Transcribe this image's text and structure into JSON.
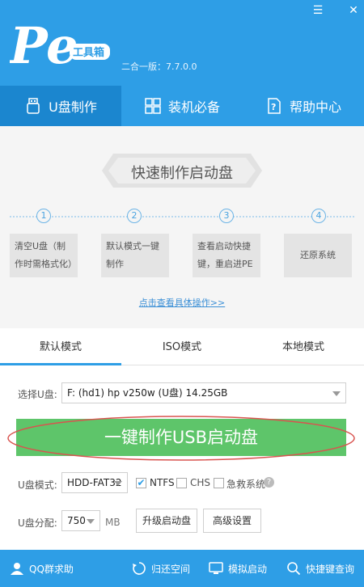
{
  "window": {
    "menu_glyph": "☰",
    "close_glyph": "✕"
  },
  "logo": {
    "badge_text": "工具箱"
  },
  "header": {
    "version": "二合一版：7.7.0.0"
  },
  "nav": {
    "tabs": [
      {
        "label": "U盘制作",
        "icon": "usb-icon"
      },
      {
        "label": "装机必备",
        "icon": "grid-icon"
      },
      {
        "label": "帮助中心",
        "icon": "help-icon"
      }
    ]
  },
  "steps": {
    "title": "快速制作启动盘",
    "numbers": [
      "1",
      "2",
      "3",
      "4"
    ],
    "items": [
      {
        "line1": "清空U盘（制",
        "line2": "作时需格式化）"
      },
      {
        "line1": "默认模式一键",
        "line2": "制作"
      },
      {
        "line1": "查看启动快捷",
        "line2": "键，重启进PE"
      },
      {
        "line1": "还原系统",
        "line2": ""
      }
    ],
    "link": "点击查看具体操作>>"
  },
  "modes": [
    "默认模式",
    "ISO模式",
    "本地模式"
  ],
  "form": {
    "select_usb_label": "选择U盘:",
    "select_usb_value": "F: (hd1) hp v250w  (U盘) 14.25GB",
    "make_button": "一键制作USB启动盘",
    "usb_mode_label": "U盘模式:",
    "usb_mode_value": "HDD-FAT32",
    "ntfs_label": "NTFS",
    "chs_label": "CHS",
    "rescue_label": "急救系统",
    "alloc_label": "U盘分配:",
    "alloc_value": "750",
    "alloc_unit": "MB",
    "upgrade_button": "升级启动盘",
    "advanced_button": "高级设置",
    "ntfs_checked": true,
    "chs_checked": false,
    "rescue_checked": false
  },
  "footer": {
    "items": [
      {
        "label": "QQ群求助",
        "icon": "user-icon"
      },
      {
        "label": "归还空间",
        "icon": "restore-icon"
      },
      {
        "label": "模拟启动",
        "icon": "monitor-icon"
      },
      {
        "label": "快捷键查询",
        "icon": "search-icon"
      }
    ]
  },
  "colors": {
    "primary": "#2e9ee6",
    "nav_active": "#1b86cf",
    "make_button": "#5ec56a",
    "highlight_oval": "#d9534f"
  }
}
